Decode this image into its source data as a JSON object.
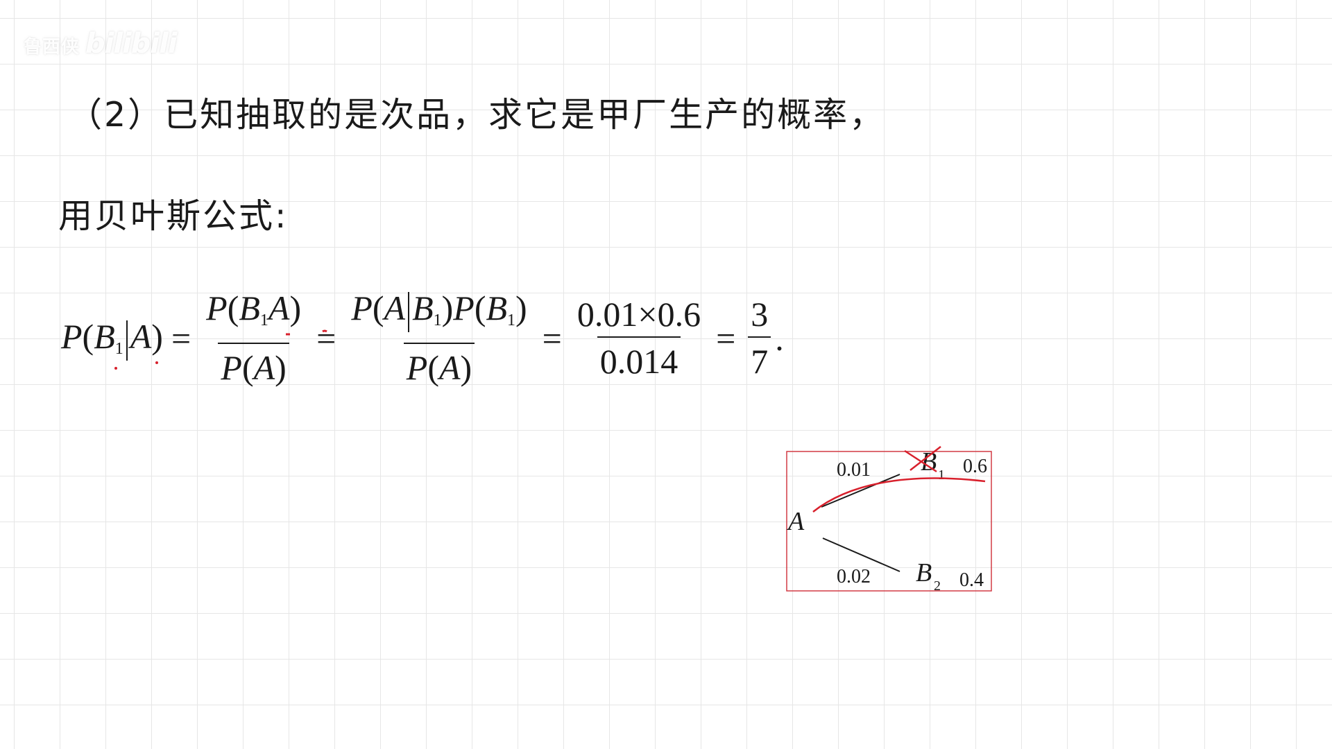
{
  "watermark": {
    "text": "鲁西侠",
    "logo": "bilibili"
  },
  "question": {
    "text": "（2）已知抽取的是次品，求它是甲厂生产的概率，"
  },
  "bayes_intro": {
    "text": "用贝叶斯公式:"
  },
  "formula": {
    "lhs": {
      "P": "P",
      "open": "(",
      "B": "B",
      "sub": "1",
      "A": "A",
      "close": ")"
    },
    "f1": {
      "num_P": "P",
      "num_open": "(",
      "num_B": "B",
      "num_sub": "1",
      "num_A": "A",
      "num_close": ")",
      "den_P": "P",
      "den_open": "(",
      "den_A": "A",
      "den_close": ")"
    },
    "f2": {
      "num_P": "P",
      "num_open": "(",
      "num_A": "A",
      "num_B": "B",
      "num_sub": "1",
      "num_close": ")",
      "num_P2": "P",
      "num_open2": "(",
      "num_B2": "B",
      "num_sub2": "1",
      "num_close2": ")",
      "den_P": "P",
      "den_open": "(",
      "den_A": "A",
      "den_close": ")"
    },
    "f3": {
      "num": "0.01×0.6",
      "den": "0.014"
    },
    "f4": {
      "num": "3",
      "den": "7"
    },
    "eq": "=",
    "period": "."
  },
  "tree": {
    "root": "A",
    "branch1": {
      "prob": "0.01",
      "node": "B",
      "sub": "1",
      "weight": "0.6"
    },
    "branch2": {
      "prob": "0.02",
      "node": "B",
      "sub": "2",
      "weight": "0.4"
    },
    "box_color": "#d23a44",
    "annotation_color": "#d8202c"
  }
}
